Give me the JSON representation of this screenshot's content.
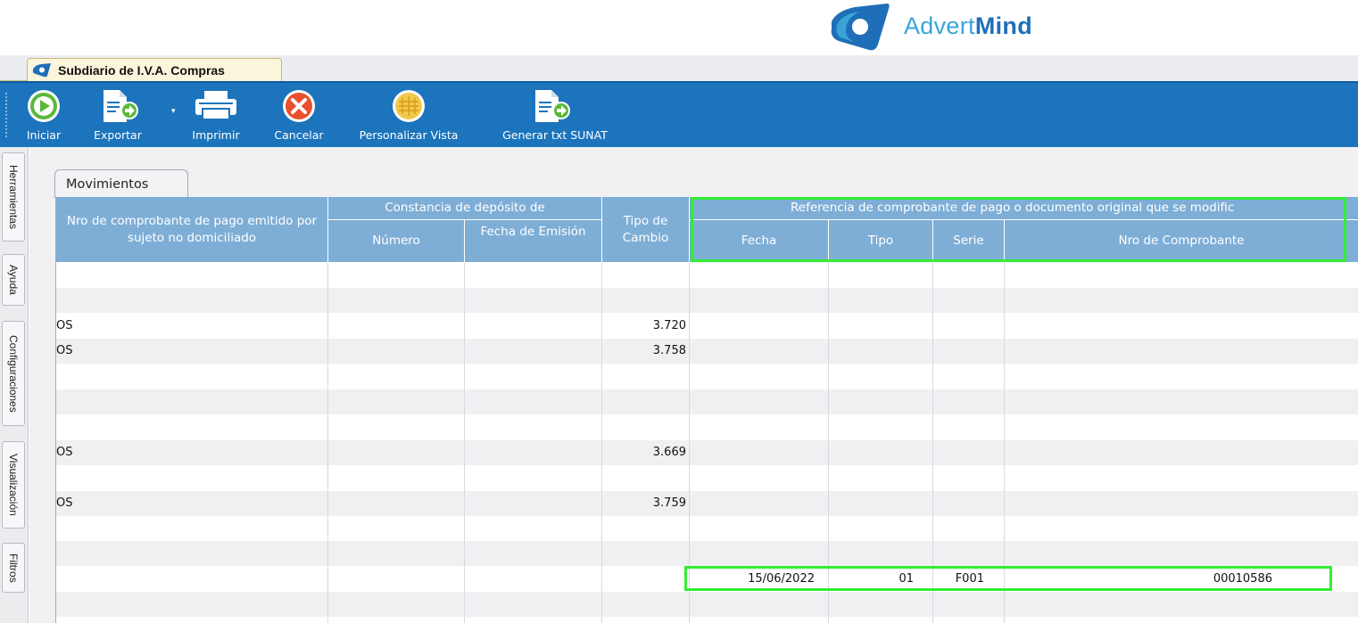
{
  "brand": {
    "name_light": "Advert",
    "name_bold": "Mind"
  },
  "window": {
    "tab_title": "Subdiario de I.V.A. Compras"
  },
  "toolbar": {
    "iniciar": "Iniciar",
    "exportar": "Exportar",
    "imprimir": "Imprimir",
    "cancelar": "Cancelar",
    "personalizar": "Personalizar Vista",
    "generar": "Generar txt SUNAT"
  },
  "side_tabs": [
    "Herramientas",
    "Ayuda",
    "Configuraciones",
    "Visualización",
    "Filtros"
  ],
  "content_tab": "Movimientos",
  "grid": {
    "headers": {
      "nro_comprobante": "Nro de comprobante de pago emitido por sujeto no domiciliado",
      "constancia_group": "Constancia de depósito de",
      "numero": "Número",
      "fecha_emision": "Fecha de Emisión",
      "tipo_cambio": "Tipo de Cambio",
      "referencia_group": "Referencia de comprobante de pago o documento original que se modific",
      "fecha": "Fecha",
      "tipo": "Tipo",
      "serie": "Serie",
      "nro_de_comprobante": "Nro de Comprobante"
    },
    "rows": [
      {
        "nro": "",
        "tipo_cambio": "",
        "fecha": "",
        "tipo": "",
        "serie": "",
        "comprobante": ""
      },
      {
        "nro": "",
        "tipo_cambio": "",
        "fecha": "",
        "tipo": "",
        "serie": "",
        "comprobante": ""
      },
      {
        "nro": "OS",
        "tipo_cambio": "3.720",
        "fecha": "",
        "tipo": "",
        "serie": "",
        "comprobante": ""
      },
      {
        "nro": "OS",
        "tipo_cambio": "3.758",
        "fecha": "",
        "tipo": "",
        "serie": "",
        "comprobante": ""
      },
      {
        "nro": "",
        "tipo_cambio": "",
        "fecha": "",
        "tipo": "",
        "serie": "",
        "comprobante": ""
      },
      {
        "nro": "",
        "tipo_cambio": "",
        "fecha": "",
        "tipo": "",
        "serie": "",
        "comprobante": ""
      },
      {
        "nro": "",
        "tipo_cambio": "",
        "fecha": "",
        "tipo": "",
        "serie": "",
        "comprobante": ""
      },
      {
        "nro": "OS",
        "tipo_cambio": "3.669",
        "fecha": "",
        "tipo": "",
        "serie": "",
        "comprobante": ""
      },
      {
        "nro": "",
        "tipo_cambio": "",
        "fecha": "",
        "tipo": "",
        "serie": "",
        "comprobante": ""
      },
      {
        "nro": "OS",
        "tipo_cambio": "3.759",
        "fecha": "",
        "tipo": "",
        "serie": "",
        "comprobante": ""
      },
      {
        "nro": "",
        "tipo_cambio": "",
        "fecha": "",
        "tipo": "",
        "serie": "",
        "comprobante": ""
      },
      {
        "nro": "",
        "tipo_cambio": "",
        "fecha": "",
        "tipo": "",
        "serie": "",
        "comprobante": ""
      },
      {
        "nro": "",
        "tipo_cambio": "",
        "fecha": "15/06/2022",
        "tipo": "01",
        "serie": "F001",
        "comprobante": "00010586"
      },
      {
        "nro": "",
        "tipo_cambio": "",
        "fecha": "",
        "tipo": "",
        "serie": "",
        "comprobante": ""
      },
      {
        "nro": "",
        "tipo_cambio": "",
        "fecha": "",
        "tipo": "",
        "serie": "",
        "comprobante": ""
      }
    ]
  },
  "colors": {
    "toolbar_bg": "#1c74bd",
    "header_bg": "#7eaed6",
    "highlight": "#33ee33",
    "tab_bg": "#fbf5dc"
  },
  "icons": {
    "iniciar": "play-icon",
    "exportar": "export-document-icon",
    "imprimir": "printer-icon",
    "cancelar": "cancel-x-icon",
    "personalizar": "grid-globe-icon",
    "generar": "export-document-icon"
  }
}
